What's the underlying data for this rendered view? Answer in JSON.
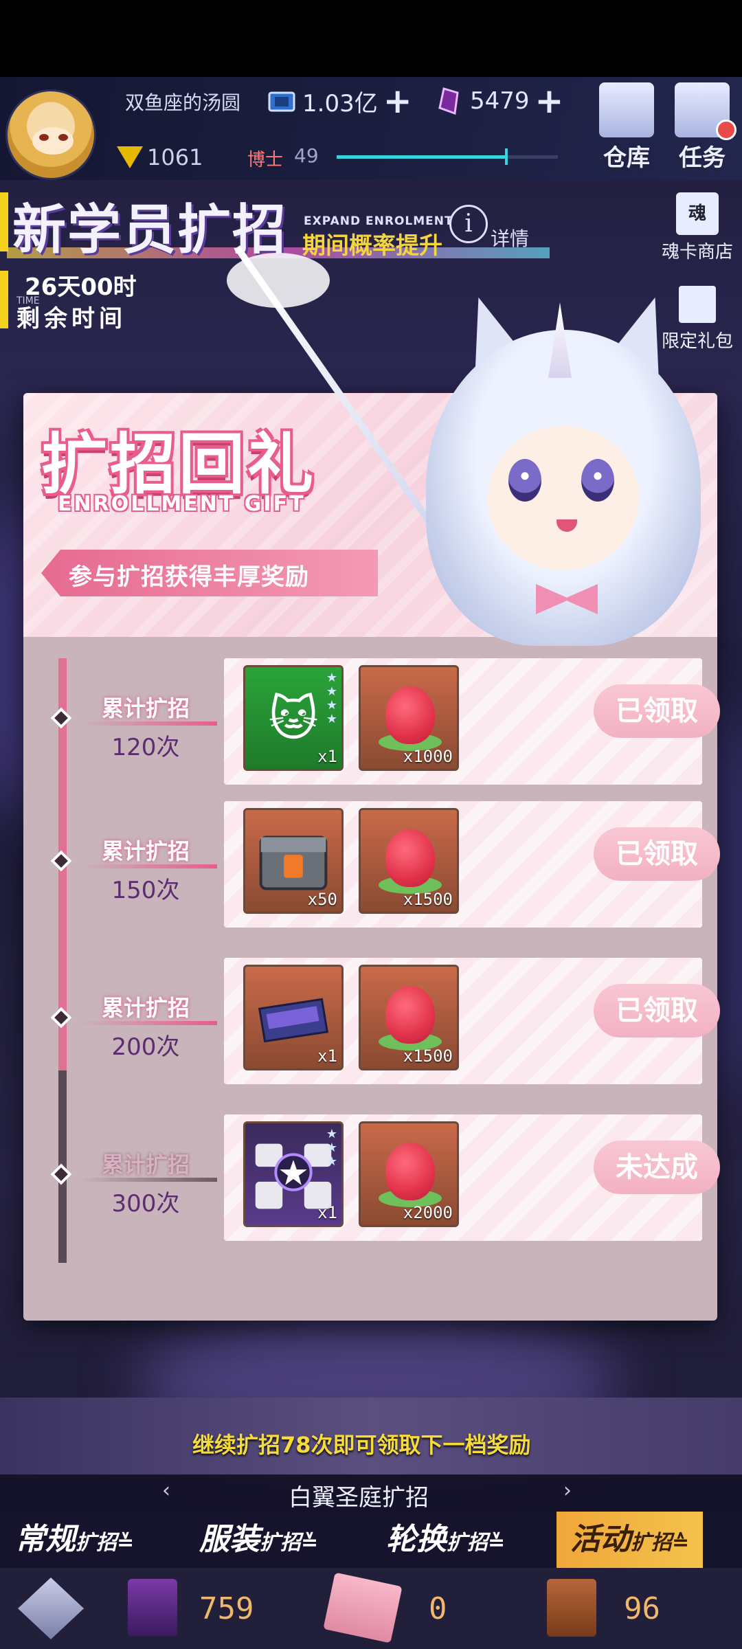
{
  "header": {
    "username": "双鱼座的汤圆",
    "currency1": "1.03亿",
    "currency2": "5479",
    "rank_value": "1061",
    "level_label": "博士",
    "level_value": "49",
    "xp_fraction": 0.76,
    "warehouse_label": "仓库",
    "tasks_label": "任务"
  },
  "banner": {
    "title": "新学员扩招",
    "subtitle_en": "EXPAND ENROLMENT",
    "rate_text": "期间概率提升",
    "detail_label": "详情",
    "info_glyph": "i",
    "timer_value": "26天00时",
    "timer_en": "TIME",
    "timer_label": "剩余时间"
  },
  "side_menu": {
    "shop_icon_text": "魂",
    "shop_label": "魂卡商店",
    "gift_label": "限定礼包"
  },
  "modal": {
    "title": "扩招回礼",
    "title_en": "ENROLLMENT GIFT",
    "subtitle": "参与扩招获得丰厚奖励",
    "tier_label": "累计扩招",
    "tiers": [
      {
        "count": "120次",
        "item1_qty": "x1",
        "item2_qty": "x1000",
        "button": "已领取",
        "reached": true
      },
      {
        "count": "150次",
        "item1_qty": "x50",
        "item2_qty": "x1500",
        "button": "已领取",
        "reached": true
      },
      {
        "count": "200次",
        "item1_qty": "x1",
        "item2_qty": "x1500",
        "button": "已领取",
        "reached": true
      },
      {
        "count": "300次",
        "item1_qty": "x1",
        "item2_qty": "x2000",
        "button": "未达成",
        "reached": false
      }
    ]
  },
  "bottom": {
    "hint": "继续扩招78次即可领取下一档奖励",
    "pool_name": "白翼圣庭扩招",
    "arrow_left": "‹",
    "arrow_right": "›",
    "tabs": [
      {
        "label": "常规",
        "suffix": "扩招"
      },
      {
        "label": "服装",
        "suffix": "扩招"
      },
      {
        "label": "轮换",
        "suffix": "扩招"
      },
      {
        "label": "活动",
        "suffix": "扩招"
      }
    ],
    "resources": [
      "759",
      "0",
      "96"
    ]
  },
  "colors": {
    "accent_pink": "#e85d8a",
    "claimed_button": "#f3b1c2",
    "hint_yellow": "#f6dc3a",
    "active_tab": "#f0a73a"
  }
}
